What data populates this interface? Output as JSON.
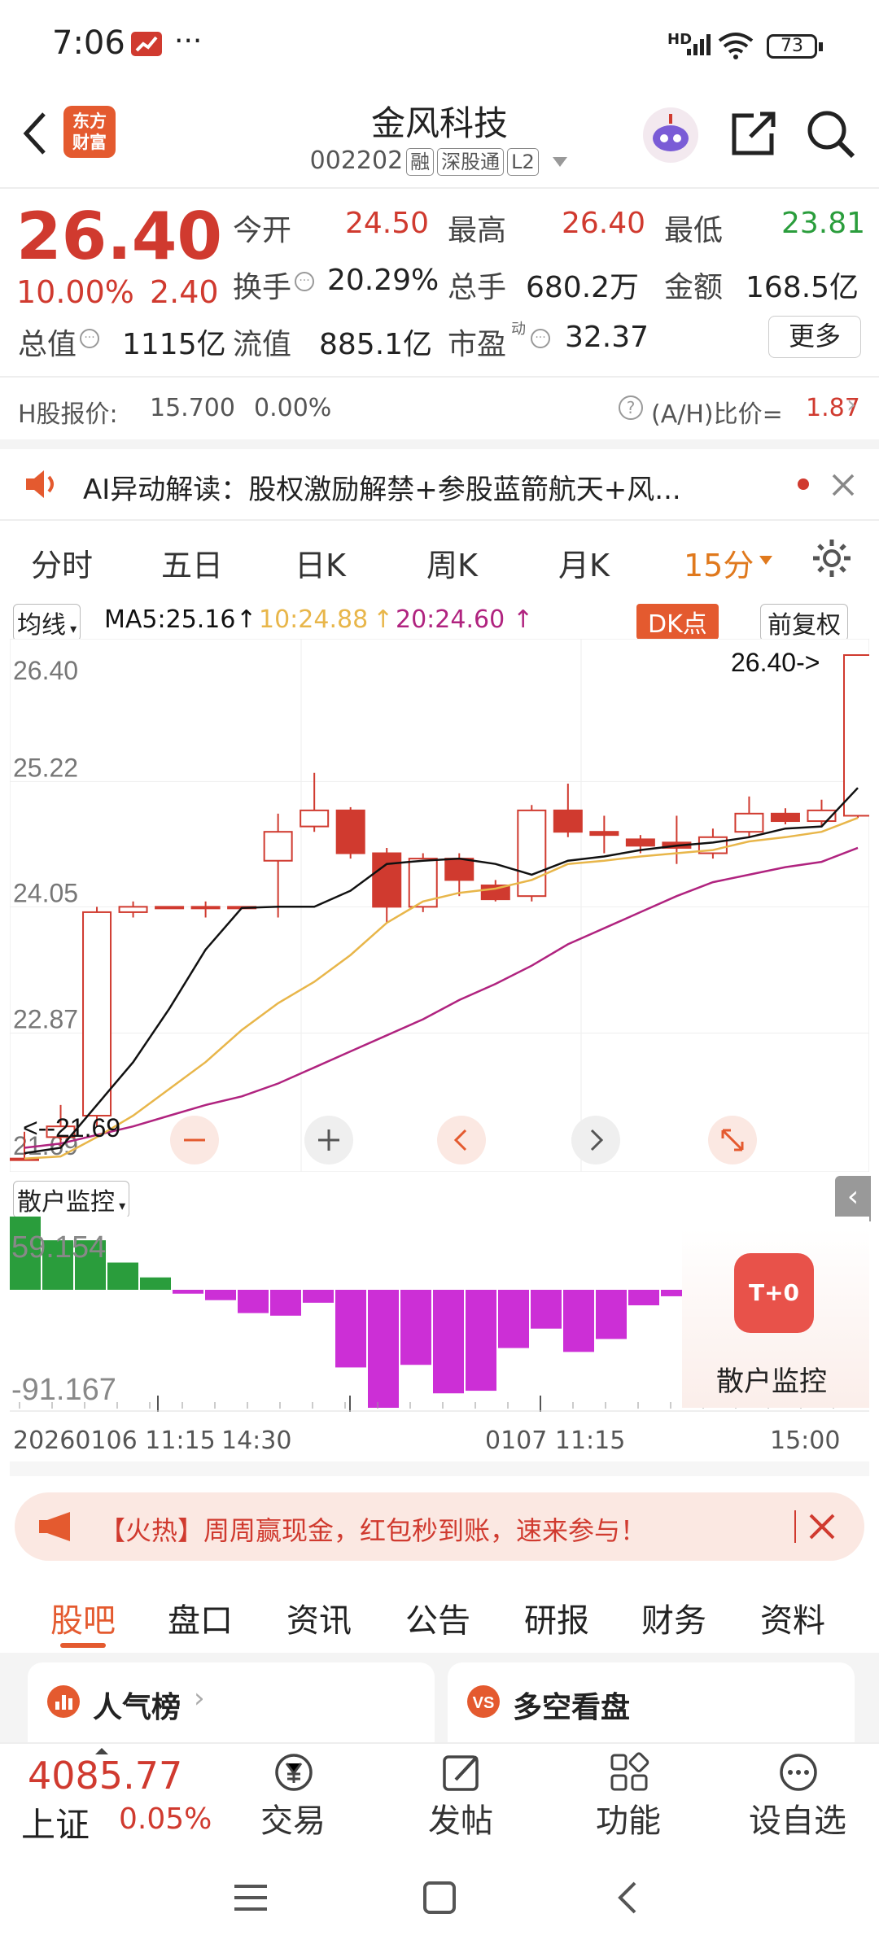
{
  "status_bar": {
    "time": "7:06",
    "dots": "···",
    "network": "HD",
    "battery": "73"
  },
  "header": {
    "back_icon": "chevron-left-icon",
    "logo_text": "东方\n财富",
    "title": "金风科技",
    "code": "002202",
    "tags": [
      "融",
      "深股通",
      "L2"
    ],
    "assistant_icon": "robot-avatar-icon"
  },
  "quote": {
    "price": "26.40",
    "change_pct": "10.00%",
    "change_amt": "2.40",
    "open_label": "今开",
    "open": "24.50",
    "high_label": "最高",
    "high": "26.40",
    "low_label": "最低",
    "low": "23.81",
    "turnover_label": "换手",
    "turnover": "20.29%",
    "volume_label": "总手",
    "volume": "680.2万",
    "amount_label": "金额",
    "amount": "168.5亿",
    "mktcap_label": "总值",
    "mktcap": "1115亿",
    "float_label": "流值",
    "float_cap": "885.1亿",
    "pe_label": "市盈",
    "pe_sup": "动",
    "pe": "32.37",
    "more_btn": "更多"
  },
  "hshare": {
    "label": "H股报价:",
    "price": "15.700",
    "pct": "0.00%",
    "ah_label": "(A/H)比价=",
    "ah_value": "1.87"
  },
  "ai_banner": {
    "text": "AI异动解读：股权激励解禁+参股蓝箭航天+风..."
  },
  "period_tabs": [
    "分时",
    "五日",
    "日K",
    "周K",
    "月K"
  ],
  "period_selected": "15分",
  "indicator": {
    "select": "均线",
    "ma5": "MA5:25.16",
    "ma10": "10:24.88",
    "ma20": "20:24.60",
    "dk": "DK点",
    "fq": "前复权"
  },
  "colors": {
    "red": "#d03a2f",
    "green": "#2a9d3c",
    "ma5": "#111111",
    "ma10": "#e8b64a",
    "ma20": "#b0237f",
    "magenta": "#cc2fd6"
  },
  "chart_data": {
    "type": "candlestick",
    "y_ticks": [
      "26.40",
      "25.22",
      "24.05",
      "22.87",
      "21.69"
    ],
    "ylim": [
      21.69,
      26.4
    ],
    "max_label": "26.40->",
    "min_label": "<--21.69",
    "candles": [
      {
        "o": 21.7,
        "c": 21.69,
        "h": 21.95,
        "l": 21.69
      },
      {
        "o": 21.9,
        "c": 22.0,
        "h": 22.2,
        "l": 21.8
      },
      {
        "o": 22.1,
        "c": 24.0,
        "h": 24.05,
        "l": 22.0
      },
      {
        "o": 24.0,
        "c": 24.05,
        "h": 24.1,
        "l": 23.95
      },
      {
        "o": 24.05,
        "c": 24.05,
        "h": 24.05,
        "l": 24.05
      },
      {
        "o": 24.05,
        "c": 24.05,
        "h": 24.1,
        "l": 23.95
      },
      {
        "o": 24.05,
        "c": 24.05,
        "h": 24.05,
        "l": 24.05
      },
      {
        "o": 24.48,
        "c": 24.75,
        "h": 24.92,
        "l": 23.95
      },
      {
        "o": 24.8,
        "c": 24.95,
        "h": 25.3,
        "l": 24.75
      },
      {
        "o": 24.95,
        "c": 24.55,
        "h": 24.98,
        "l": 24.5
      },
      {
        "o": 24.55,
        "c": 24.05,
        "h": 24.6,
        "l": 23.9
      },
      {
        "o": 24.05,
        "c": 24.5,
        "h": 24.55,
        "l": 24.0
      },
      {
        "o": 24.5,
        "c": 24.3,
        "h": 24.55,
        "l": 24.15
      },
      {
        "o": 24.25,
        "c": 24.12,
        "h": 24.3,
        "l": 24.1
      },
      {
        "o": 24.15,
        "c": 24.95,
        "h": 25.0,
        "l": 24.1
      },
      {
        "o": 24.95,
        "c": 24.75,
        "h": 25.2,
        "l": 24.7
      },
      {
        "o": 24.75,
        "c": 24.72,
        "h": 24.9,
        "l": 24.55
      },
      {
        "o": 24.68,
        "c": 24.62,
        "h": 24.72,
        "l": 24.55
      },
      {
        "o": 24.65,
        "c": 24.6,
        "h": 24.9,
        "l": 24.45
      },
      {
        "o": 24.55,
        "c": 24.7,
        "h": 24.78,
        "l": 24.5
      },
      {
        "o": 24.75,
        "c": 24.92,
        "h": 25.08,
        "l": 24.7
      },
      {
        "o": 24.92,
        "c": 24.85,
        "h": 24.97,
        "l": 24.82
      },
      {
        "o": 24.85,
        "c": 24.95,
        "h": 25.05,
        "l": 24.8
      },
      {
        "o": 24.9,
        "c": 26.4,
        "h": 26.4,
        "l": 24.88
      }
    ],
    "ma5": [
      21.75,
      21.8,
      22.2,
      22.6,
      23.1,
      23.65,
      24.04,
      24.05,
      24.05,
      24.2,
      24.45,
      24.48,
      24.5,
      24.45,
      24.35,
      24.48,
      24.52,
      24.58,
      24.62,
      24.65,
      24.7,
      24.78,
      24.8,
      25.16
    ],
    "ma10": [
      21.7,
      21.72,
      21.9,
      22.1,
      22.35,
      22.6,
      22.9,
      23.15,
      23.35,
      23.6,
      23.9,
      24.1,
      24.18,
      24.22,
      24.3,
      24.45,
      24.48,
      24.52,
      24.55,
      24.58,
      24.66,
      24.7,
      24.75,
      24.88
    ],
    "ma20": [
      21.8,
      21.84,
      21.92,
      22.0,
      22.1,
      22.2,
      22.28,
      22.4,
      22.55,
      22.7,
      22.85,
      23.0,
      23.18,
      23.33,
      23.5,
      23.7,
      23.85,
      24.0,
      24.15,
      24.28,
      24.35,
      24.42,
      24.47,
      24.6
    ]
  },
  "chart_controls": [
    "minus-icon",
    "plus-icon",
    "chevron-left-icon",
    "chevron-right-icon",
    "expand-icon"
  ],
  "retail_monitor": {
    "select": "散户监控",
    "max_label": "59.154",
    "min_label": "-91.167",
    "badge": "T+0",
    "badge_label": "散户监控",
    "bars": [
      59.154,
      40,
      40,
      22,
      10,
      -3,
      -8,
      -18,
      -20,
      -10,
      -60,
      -91.167,
      -58,
      -80,
      -78,
      -45,
      -30,
      -48,
      -38,
      -12,
      -5
    ]
  },
  "x_axis": {
    "labels": [
      "20260106 11:15",
      "14:30",
      "0107 11:15",
      "15:00"
    ]
  },
  "promo": {
    "text": "【火热】周周赢现金，红包秒到账，速来参与！"
  },
  "section_tabs": [
    "股吧",
    "盘口",
    "资讯",
    "公告",
    "研报",
    "财务",
    "资料"
  ],
  "section_selected": "股吧",
  "cards": [
    {
      "label": "人气榜"
    },
    {
      "label": "多空看盘"
    }
  ],
  "bottom": {
    "index_value": "4085.77",
    "index_name": "上证",
    "index_pct": "0.05%",
    "trade": "交易",
    "post": "发帖",
    "func": "功能",
    "watch": "设自选"
  }
}
